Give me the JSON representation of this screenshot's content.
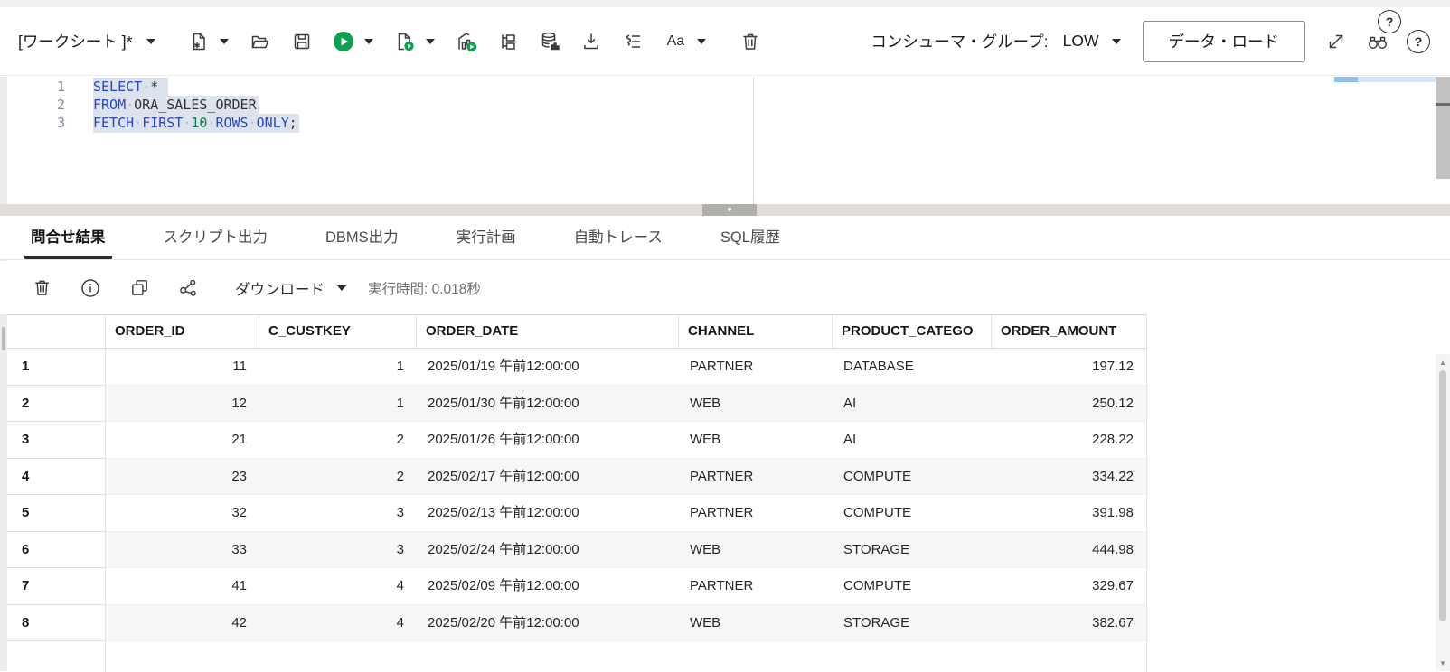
{
  "toolbar": {
    "worksheet_label": "[ワークシート ]*",
    "consumer_group_label": "コンシューマ・グループ:",
    "consumer_group_value": "LOW",
    "data_load_label": "データ・ロード",
    "font_toggle_label": "Aa"
  },
  "icons": {
    "help": "?",
    "info": "i",
    "splitter_collapse": "▼",
    "scroll_up": "▲",
    "scroll_down": "▼"
  },
  "editor": {
    "lines": [
      {
        "number": "1",
        "selected": true,
        "tokens": [
          {
            "t": "SELECT",
            "c": "kw"
          },
          {
            "t": "·",
            "c": "ws"
          },
          {
            "t": "* ",
            "c": "pl"
          }
        ]
      },
      {
        "number": "2",
        "selected": true,
        "tokens": [
          {
            "t": "FROM",
            "c": "kw"
          },
          {
            "t": "·",
            "c": "ws"
          },
          {
            "t": "ORA_SALES_ORDER",
            "c": "pl"
          }
        ]
      },
      {
        "number": "3",
        "selected": true,
        "tokens": [
          {
            "t": "FETCH",
            "c": "kw"
          },
          {
            "t": "·",
            "c": "ws"
          },
          {
            "t": "FIRST",
            "c": "kw"
          },
          {
            "t": "·",
            "c": "ws"
          },
          {
            "t": "10",
            "c": "num"
          },
          {
            "t": "·",
            "c": "ws"
          },
          {
            "t": "ROWS",
            "c": "kw"
          },
          {
            "t": "·",
            "c": "ws"
          },
          {
            "t": "ONLY",
            "c": "kw"
          },
          {
            "t": ";",
            "c": "pl"
          }
        ]
      }
    ]
  },
  "tabs": [
    {
      "name": "query-result",
      "label": "問合せ結果",
      "active": true
    },
    {
      "name": "script-output",
      "label": "スクリプト出力",
      "active": false
    },
    {
      "name": "dbms-output",
      "label": "DBMS出力",
      "active": false
    },
    {
      "name": "explain-plan",
      "label": "実行計画",
      "active": false
    },
    {
      "name": "autotrace",
      "label": "自動トレース",
      "active": false
    },
    {
      "name": "sql-history",
      "label": "SQL履歴",
      "active": false
    }
  ],
  "results_toolbar": {
    "download_label": "ダウンロード",
    "execution_time": "実行時間: 0.018秒"
  },
  "grid": {
    "columns": [
      {
        "label": "ORDER_ID",
        "align": "right"
      },
      {
        "label": "C_CUSTKEY",
        "align": "right"
      },
      {
        "label": "ORDER_DATE",
        "align": "left"
      },
      {
        "label": "CHANNEL",
        "align": "left"
      },
      {
        "label": "PRODUCT_CATEGO",
        "align": "left"
      },
      {
        "label": "ORDER_AMOUNT",
        "align": "right"
      }
    ],
    "rows": [
      [
        "1",
        "11",
        "1",
        "2025/01/19 午前12:00:00",
        "PARTNER",
        "DATABASE",
        "197.12"
      ],
      [
        "2",
        "12",
        "1",
        "2025/01/30 午前12:00:00",
        "WEB",
        "AI",
        "250.12"
      ],
      [
        "3",
        "21",
        "2",
        "2025/01/26 午前12:00:00",
        "WEB",
        "AI",
        "228.22"
      ],
      [
        "4",
        "23",
        "2",
        "2025/02/17 午前12:00:00",
        "PARTNER",
        "COMPUTE",
        "334.22"
      ],
      [
        "5",
        "32",
        "3",
        "2025/02/13 午前12:00:00",
        "PARTNER",
        "COMPUTE",
        "391.98"
      ],
      [
        "6",
        "33",
        "3",
        "2025/02/24 午前12:00:00",
        "WEB",
        "STORAGE",
        "444.98"
      ],
      [
        "7",
        "41",
        "4",
        "2025/02/09 午前12:00:00",
        "PARTNER",
        "COMPUTE",
        "329.67"
      ],
      [
        "8",
        "42",
        "4",
        "2025/02/20 午前12:00:00",
        "WEB",
        "STORAGE",
        "382.67"
      ]
    ]
  }
}
